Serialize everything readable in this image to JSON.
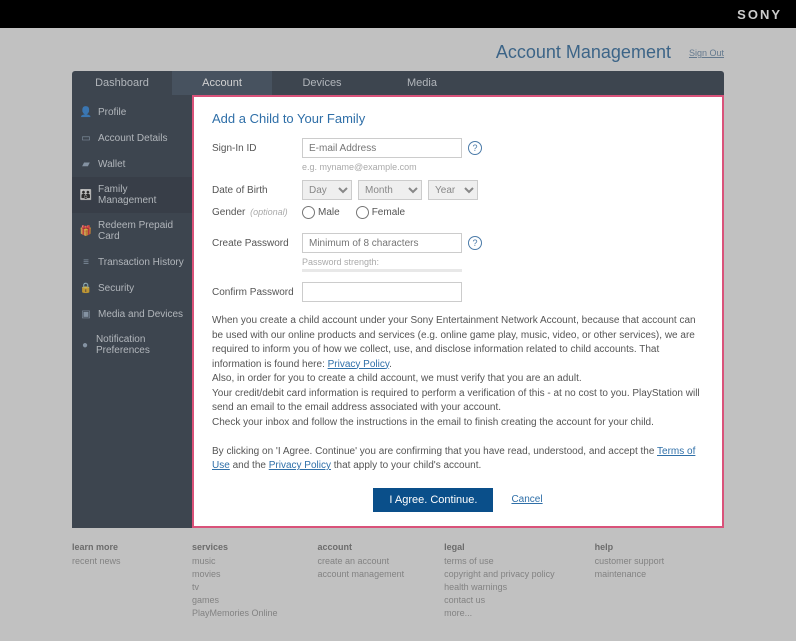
{
  "brand": "SONY",
  "header": {
    "title": "Account Management",
    "signout": "Sign Out"
  },
  "tabs": [
    {
      "label": "Dashboard"
    },
    {
      "label": "Account"
    },
    {
      "label": "Devices"
    },
    {
      "label": "Media"
    }
  ],
  "active_tab": 1,
  "sidebar": [
    {
      "icon": "person",
      "label": "Profile"
    },
    {
      "icon": "card",
      "label": "Account Details"
    },
    {
      "icon": "wallet",
      "label": "Wallet"
    },
    {
      "icon": "family",
      "label": "Family Management"
    },
    {
      "icon": "gift",
      "label": "Redeem Prepaid Card"
    },
    {
      "icon": "history",
      "label": "Transaction History"
    },
    {
      "icon": "lock",
      "label": "Security"
    },
    {
      "icon": "devices",
      "label": "Media and Devices"
    },
    {
      "icon": "bell",
      "label": "Notification Preferences"
    }
  ],
  "active_side": 3,
  "form": {
    "title": "Add a Child to Your Family",
    "signin_label": "Sign-In ID",
    "signin_placeholder": "E-mail Address",
    "signin_hint": "e.g. myname@example.com",
    "dob_label": "Date of Birth",
    "dob_day": "Day",
    "dob_month": "Month",
    "dob_year": "Year",
    "gender_label": "Gender",
    "gender_optional": "(optional)",
    "gender_male": "Male",
    "gender_female": "Female",
    "pw_label": "Create Password",
    "pw_placeholder": "Minimum of 8 characters",
    "pw_strength": "Password strength:",
    "confirm_label": "Confirm Password",
    "info1a": "When you create a child account under your Sony Entertainment Network Account, because that account can be used with our online products and services (e.g. online game play, music, video, or other services), we are required to inform you of how we collect, use, and disclose information related to child accounts. That information is found here: ",
    "privacy": "Privacy Policy",
    "info2": "Also, in order for you to create a child account, we must verify that you are an adult.",
    "info3": "Your credit/debit card information is required to perform a verification of this - at no cost to you. PlayStation will send an email to the email address associated with your account.",
    "info4": "Check your inbox and follow the instructions in the email to finish creating the account for your child.",
    "info5a": "By clicking on 'I Agree. Continue' you are confirming that you have read, understood, and accept the ",
    "terms": "Terms of Use",
    "info5b": " and the ",
    "info5c": " that apply to your child's account.",
    "agree_btn": "I Agree. Continue.",
    "cancel": "Cancel"
  },
  "footer": {
    "c0": {
      "h": "learn more",
      "items": [
        "recent news"
      ]
    },
    "c1": {
      "h": "services",
      "items": [
        "music",
        "movies",
        "tv",
        "games",
        "PlayMemories Online"
      ]
    },
    "c2": {
      "h": "account",
      "items": [
        "create an account",
        "account management"
      ]
    },
    "c3": {
      "h": "legal",
      "items": [
        "terms of use",
        "copyright and privacy policy",
        "health warnings",
        "contact us",
        "more..."
      ]
    },
    "c4": {
      "h": "help",
      "items": [
        "customer support",
        "maintenance"
      ]
    }
  }
}
